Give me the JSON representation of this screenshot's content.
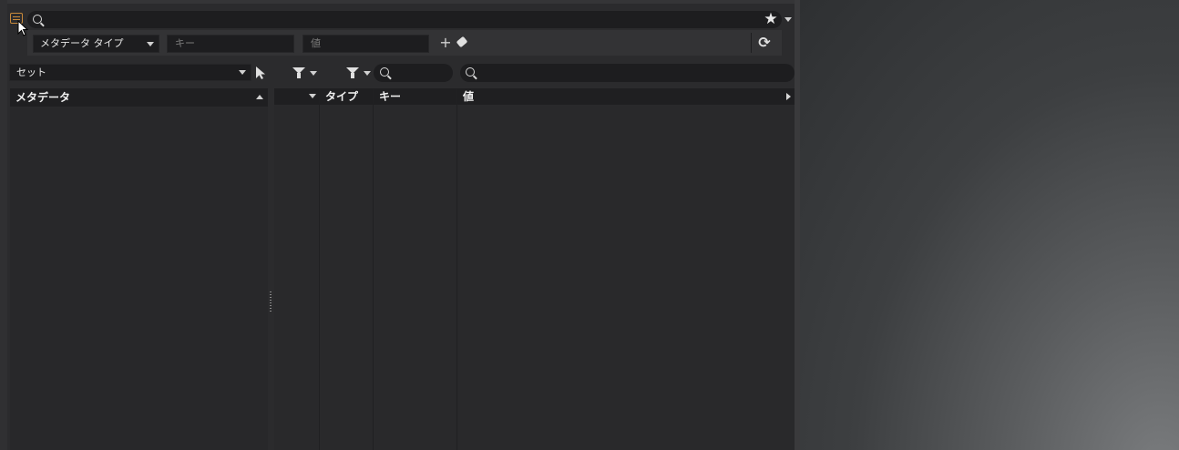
{
  "toolbar": {
    "global_search_value": "",
    "metadata_type_label": "メタデータ タイプ",
    "key_placeholder": "キー",
    "value_placeholder": "値"
  },
  "sets": {
    "selected": "セット",
    "search_value": "",
    "table_search_value": ""
  },
  "left_list": {
    "header": "メタデータ",
    "items": []
  },
  "table": {
    "columns": [
      "",
      "タイプ",
      "キー",
      "値"
    ],
    "rows": []
  },
  "colors": {
    "panel_bg": "#2b2b2d",
    "field_bg": "#1d1d1f",
    "header_bg": "#1f1f21",
    "icon_accent": "#c8893a"
  },
  "icons": {
    "panel": "panel-icon",
    "search": "search-icon",
    "favorite": "star-icon",
    "add": "plus-icon",
    "clear": "eraser-icon",
    "refresh": "refresh-icon",
    "select": "pointer-icon",
    "filter": "filter-icon"
  }
}
